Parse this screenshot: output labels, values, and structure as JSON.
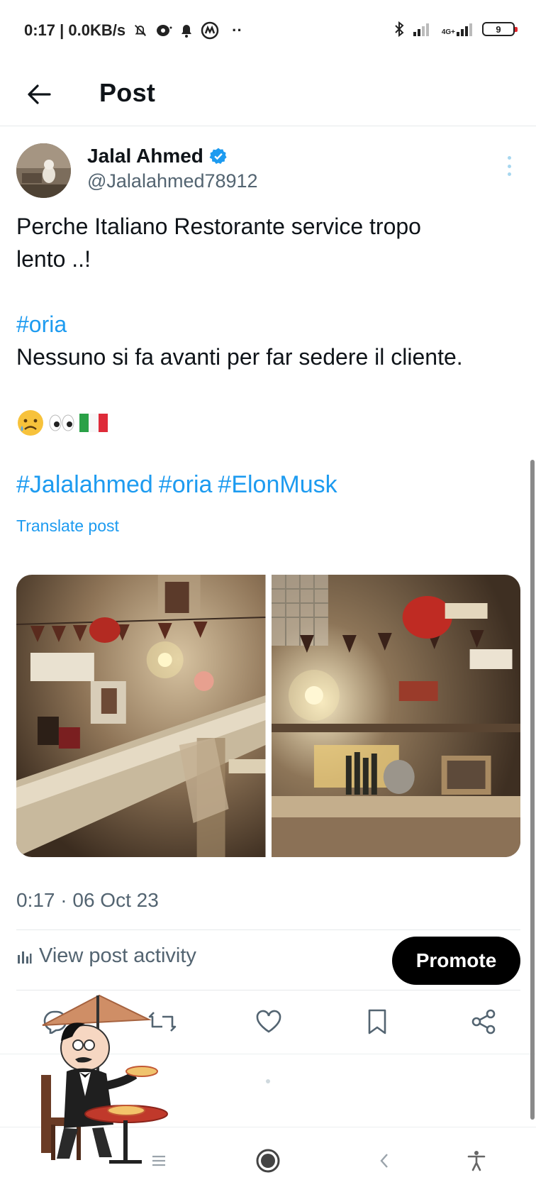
{
  "status_bar": {
    "time_speed": "0:17 | 0.0KB/s",
    "more": "··",
    "net_label_top": "4G+",
    "battery": "9"
  },
  "header": {
    "title": "Post",
    "back_icon": "arrow-left-icon"
  },
  "post": {
    "author": {
      "name": "Jalal Ahmed",
      "handle": "@Jalalahmed78912",
      "verified_icon": "verified-badge-icon"
    },
    "text_line1": "Perche Italiano Restorante service tropo",
    "text_line2": "lento ..!",
    "hashtag1": "#oria",
    "text_line3": "Nessuno si fa avanti per far sedere il cliente.",
    "emojis": [
      "sad-face-emoji",
      "eyes-emoji",
      "italy-flag-emoji"
    ],
    "tags": [
      "#Jalalahmed",
      "#oria",
      "#ElonMusk"
    ],
    "translate_label": "Translate post",
    "timestamp": "0:17 · 06 Oct 23",
    "activity_label": "View post activity",
    "promote_label": "Promote"
  },
  "actions": [
    "reply-icon",
    "repost-icon",
    "like-icon",
    "bookmark-icon",
    "share-icon"
  ],
  "colors": {
    "accent": "#1d9bf0",
    "text": "#0f1419",
    "muted": "#536471",
    "promote_bg": "#000000"
  },
  "nav": [
    "menu-icon",
    "home-circle-icon",
    "back-chevron-icon",
    "accessibility-icon"
  ]
}
